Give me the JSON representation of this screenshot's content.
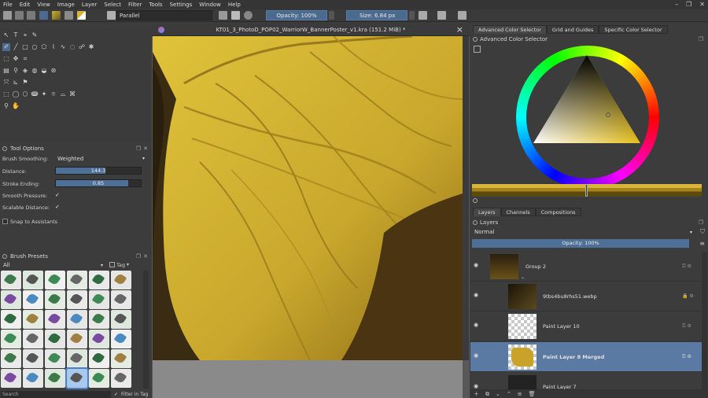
{
  "menu": [
    "File",
    "Edit",
    "View",
    "Image",
    "Layer",
    "Select",
    "Filter",
    "Tools",
    "Settings",
    "Window",
    "Help"
  ],
  "toolbar": {
    "brush_mode": "Parallel",
    "opacity_label": "Opacity: 100%",
    "size_label": "Size: 6.84 px"
  },
  "document": {
    "tab_title": "KT01_3_PhotoD_POP02_WarriorW_BannerPoster_v1.kra (151.2 MiB) *",
    "close_glyph": "×"
  },
  "tool_options": {
    "title": "Tool Options",
    "brush_smoothing_label": "Brush Smoothing:",
    "brush_smoothing_value": "Weighted",
    "distance_label": "Distance:",
    "distance_value": "144.3",
    "distance_fraction": 0.58,
    "stroke_ending_label": "Stroke Ending:",
    "stroke_ending_value": "0.85",
    "stroke_ending_fraction": 0.85,
    "smooth_pressure_label": "Smooth Pressure:",
    "smooth_pressure_checked": true,
    "scalable_distance_label": "Scalable Distance:",
    "scalable_distance_checked": true,
    "snap_label": "Snap to Assistants",
    "snap_checked": false
  },
  "brush_presets": {
    "title": "Brush Presets",
    "filter_value": "All",
    "tag_label": "Tag",
    "search_placeholder": "Search",
    "filter_in_tag_label": "Filter in Tag"
  },
  "color_selector": {
    "tabs": [
      "Advanced Color Selector",
      "Grid and Guides",
      "Specific Color Selector"
    ],
    "active_tab": 0,
    "panel_title": "Advanced Color Selector",
    "current_color": "#d8b53a"
  },
  "layers": {
    "tabs": [
      "Layers",
      "Channels",
      "Compositions"
    ],
    "panel_title": "Layers",
    "blend_mode": "Normal",
    "opacity_label": "Opacity:  100%",
    "items": [
      {
        "name": "Group 2",
        "type": "group",
        "selected": false
      },
      {
        "name": "9tbs4bu8rhs51.webp",
        "type": "image",
        "selected": false
      },
      {
        "name": "Paint Layer 10",
        "type": "empty",
        "selected": false
      },
      {
        "name": "Paint Layer 8 Merged",
        "type": "paint",
        "selected": true
      },
      {
        "name": "Paint Layer 7",
        "type": "paint",
        "selected": false
      }
    ]
  },
  "colors": {
    "accent": "#4b6a8f",
    "selection": "#5a7aa3",
    "panel_bg": "#3c3c3c",
    "canvas_yellow": "#d6b52e"
  }
}
